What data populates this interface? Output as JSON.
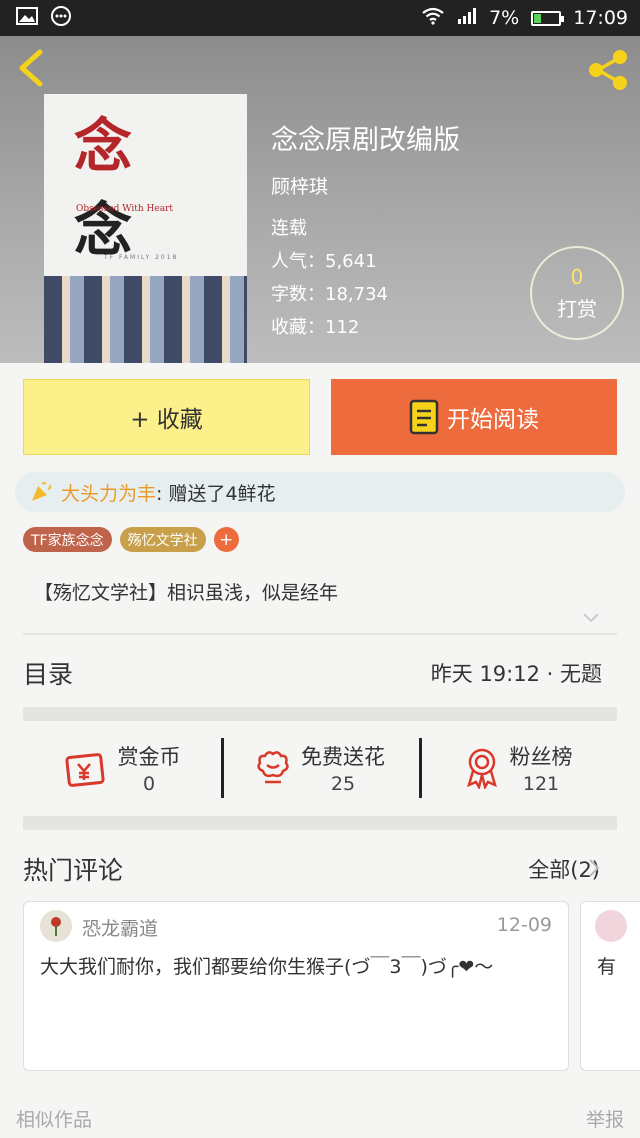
{
  "status_bar": {
    "battery": "7%",
    "time": "17:09",
    "battery_level": 0.07,
    "battery_color": "#59d259"
  },
  "header": {
    "cover": {
      "title_char_1": "念",
      "title_char_2": "念",
      "subtitle": "Obsessed With Heart",
      "small_text": "TF FAMILY 2018"
    },
    "title": "念念原剧改编版",
    "author": "顾梓琪",
    "status": "连载",
    "popularity": "人气：5,641",
    "word_count": "字数：18,734",
    "favorites": "收藏：112",
    "reward": {
      "count": "0",
      "label": "打赏"
    }
  },
  "actions": {
    "favorite_label": "+ 收藏",
    "read_label": "开始阅读"
  },
  "gift": {
    "user": "大头力为丰",
    "text": ": 赠送了4鲜花"
  },
  "tags": [
    {
      "label": "TF家族念念",
      "color": "#c0634b"
    },
    {
      "label": "殇忆文学社",
      "color": "#c9a04a"
    }
  ],
  "tag_add_label": "+",
  "intro": "【殇忆文学社】相识虽浅，似是经年",
  "toc": {
    "title": "目录",
    "latest": "昨天 19:12 · 无题"
  },
  "stats": [
    {
      "label": "赏金币",
      "value": "0",
      "icon": "red-envelope-icon"
    },
    {
      "label": "免费送花",
      "value": "25",
      "icon": "flower-icon"
    },
    {
      "label": "粉丝榜",
      "value": "121",
      "icon": "medal-icon"
    }
  ],
  "comments": {
    "title": "热门评论",
    "all_label": "全部(2)",
    "items": [
      {
        "user": "恐龙霸道",
        "date": "12-09",
        "body": "大大我们耐你，我们都要给你生猴子(づ￣3￣)づ╭❤～"
      },
      {
        "body": "有"
      }
    ]
  },
  "footer": {
    "similar": "相似作品",
    "report": "举报"
  },
  "colors": {
    "accent_orange": "#ed6b3c",
    "fav_yellow": "#fbf089",
    "reward_gold": "#ffe56b",
    "icon_red": "#d9382b"
  }
}
